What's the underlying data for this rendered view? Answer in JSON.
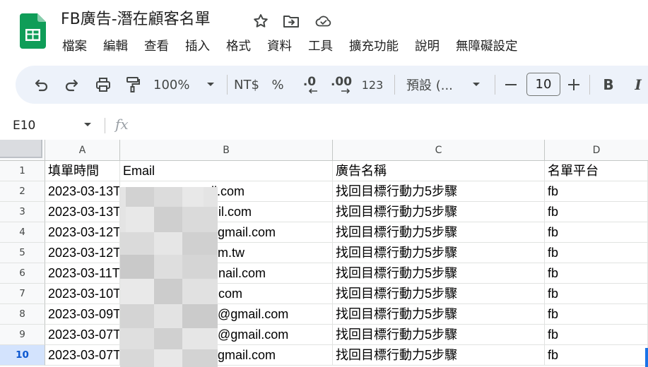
{
  "document": {
    "title": "FB廣告-潛在顧客名單"
  },
  "menu": [
    "檔案",
    "編輯",
    "查看",
    "插入",
    "格式",
    "資料",
    "工具",
    "擴充功能",
    "說明",
    "無障礙設定"
  ],
  "toolbar": {
    "zoom": "100%",
    "currency": "NT$",
    "percent": "%",
    "decrease_decimal": ".0",
    "increase_decimal": ".00",
    "number_format": "123",
    "font": "預設 (...",
    "font_size": "10",
    "bold": "B",
    "italic": "I"
  },
  "formula_bar": {
    "name_box": "E10",
    "fx": "fx",
    "value": ""
  },
  "columns": [
    "A",
    "B",
    "C",
    "D"
  ],
  "row_numbers": [
    "1",
    "2",
    "3",
    "4",
    "5",
    "6",
    "7",
    "8",
    "9",
    "10"
  ],
  "active_row": "10",
  "rows": [
    [
      "填單時間",
      "Email",
      "廣告名稱",
      "名單平台"
    ],
    [
      "2023-03-13T",
      "ail.com",
      "找回目標行動力5步驟",
      "fb"
    ],
    [
      "2023-03-13T",
      "il.com",
      "找回目標行動力5步驟",
      "fb"
    ],
    [
      "2023-03-12T",
      "gmail.com",
      "找回目標行動力5步驟",
      "fb"
    ],
    [
      "2023-03-12T",
      "m.tw",
      "找回目標行動力5步驟",
      "fb"
    ],
    [
      "2023-03-11T",
      "nail.com",
      "找回目標行動力5步驟",
      "fb"
    ],
    [
      "2023-03-10T",
      "com",
      "找回目標行動力5步驟",
      "fb"
    ],
    [
      "2023-03-09T",
      "@gmail.com",
      "找回目標行動力5步驟",
      "fb"
    ],
    [
      "2023-03-07T",
      "@gmail.com",
      "找回目標行動力5步驟",
      "fb"
    ],
    [
      "2023-03-07T",
      "gmail.com",
      "找回目標行動力5步驟",
      "fb"
    ]
  ]
}
